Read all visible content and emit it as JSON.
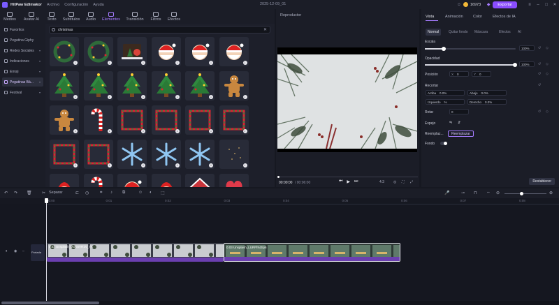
{
  "titlebar": {
    "app_name": "HitPaw Edimakor",
    "menu": [
      "Archivo",
      "Configuración",
      "Ayuda"
    ],
    "file_title": "2025-12-09_01",
    "credits": "16973",
    "export_label": "Exportar"
  },
  "toolbar": {
    "tabs": [
      "Medios",
      "Avatar AI",
      "Texto",
      "Subtítulos",
      "Audio",
      "Elementos",
      "Transición",
      "Filtros",
      "Efectos"
    ],
    "active": "Elementos"
  },
  "sidebar": {
    "items": [
      {
        "label": "Favoritos",
        "arrow": ""
      },
      {
        "label": "Pegatina Giphy",
        "arrow": ""
      },
      {
        "label": "Redes Sociales",
        "arrow": "▾"
      },
      {
        "label": "Indicaciones",
        "arrow": "▾"
      },
      {
        "label": "Emoji",
        "arrow": "▾"
      },
      {
        "label": "Pegatinas Bá...",
        "arrow": "▾"
      },
      {
        "label": "Festival",
        "arrow": "▾"
      }
    ],
    "active_index": 5
  },
  "search": {
    "value": "christmas"
  },
  "elements": [
    "wreath-icon",
    "wreath-icon",
    "christmas-scene-icon",
    "santa-icon",
    "santa-icon",
    "santa-icon",
    "christmas-tree-icon",
    "christmas-tree-icon",
    "christmas-tree-icon",
    "christmas-tree-icon",
    "christmas-tree-icon",
    "gingerbread-icon",
    "gingerbread-icon",
    "candy-cane-icon",
    "frame-icon",
    "frame-icon",
    "frame-icon",
    "frame-icon",
    "frame-icon",
    "frame-icon",
    "snowflake-icon",
    "snowflake-icon",
    "snowflake-icon",
    "sparkle-icon",
    "character-icon",
    "candy-cane-icon",
    "santa-icon",
    "character-icon",
    "house-icon",
    "heart-icon"
  ],
  "player": {
    "title": "Reproductor",
    "time_current": "00:00:00",
    "time_total": "/ 00:06:00",
    "aspect": "4:3"
  },
  "props": {
    "tabs": [
      "Vista",
      "Animación",
      "Color",
      "Efectos de IA"
    ],
    "subtabs": [
      "Normal",
      "Quitar fondo",
      "Máscara",
      "Efectos",
      "AI"
    ],
    "escala": {
      "label": "Escala",
      "value": "100%",
      "level": 1.0
    },
    "opacidad": {
      "label": "Opacidad",
      "value": "100%",
      "level": 1.0
    },
    "posicion": {
      "label": "Posición",
      "x_label": "X",
      "x": "0",
      "y_label": "Y",
      "y": "0"
    },
    "recortar": {
      "label": "Recortar",
      "arriba": "Arriba",
      "arriba_val": "0.0%",
      "abajo": "Abajo",
      "abajo_val": "0.0%",
      "izquierdo": "Izquierdo",
      "izquierdo_val": "%",
      "derecho": "Derecho",
      "derecho_val": "0.0%"
    },
    "rotar": {
      "label": "Rotar",
      "value": "0"
    },
    "espejo": {
      "label": "Espejo"
    },
    "reemplazar": {
      "label": "Reemplaz...",
      "button": "Reemplazar"
    },
    "fondo": {
      "label": "Fondo"
    },
    "reset": "Restablecer"
  },
  "timeline": {
    "split_label": "Separar",
    "ruler": [
      "00:00",
      "0:01",
      "0:02",
      "0:03",
      "0:04",
      "0:05",
      "0:06",
      "0:07",
      "0:08"
    ],
    "track_label": "Portada",
    "clips": [
      {
        "name": "0.03  Unsplash_VDK6VR1V_7A"
      },
      {
        "name": "0.03  Unsplash_LURFhN2Ip6"
      }
    ]
  }
}
